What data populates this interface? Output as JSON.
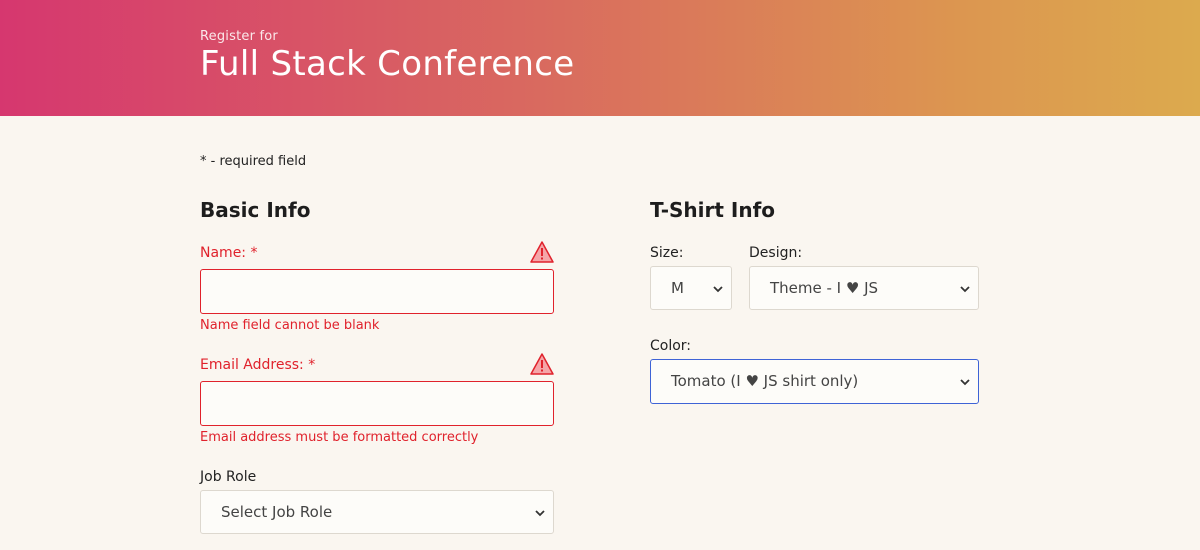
{
  "header": {
    "pre_title": "Register for",
    "title": "Full Stack Conference"
  },
  "required_note": "* - required field",
  "basic_info": {
    "title": "Basic Info",
    "name": {
      "label": "Name:",
      "required_mark": "*",
      "value": "",
      "error": "Name field cannot be blank"
    },
    "email": {
      "label": "Email Address:",
      "required_mark": "*",
      "value": "",
      "error": "Email address must be formatted correctly"
    },
    "job_role": {
      "label": "Job Role",
      "selected": "Select Job Role"
    }
  },
  "tshirt_info": {
    "title": "T-Shirt Info",
    "size": {
      "label": "Size:",
      "selected": "M"
    },
    "design": {
      "label": "Design:",
      "selected": "Theme - I ♥ JS"
    },
    "color": {
      "label": "Color:",
      "selected": "Tomato (I ♥ JS shirt only)"
    }
  },
  "icons": {
    "warning": "warning-icon",
    "dropdown": "chevron-down-icon"
  },
  "colors": {
    "error": "#e0222c",
    "focus": "#3e63d6",
    "header_start": "#d6376f",
    "header_end": "#dcaa4e",
    "background": "#faf6f0"
  }
}
